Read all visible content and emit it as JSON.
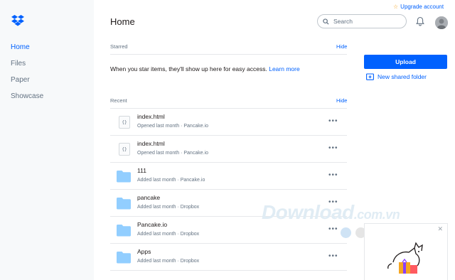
{
  "sidebar": {
    "items": [
      {
        "label": "Home"
      },
      {
        "label": "Files"
      },
      {
        "label": "Paper"
      },
      {
        "label": "Showcase"
      }
    ]
  },
  "header": {
    "title": "Home",
    "search_placeholder": "Search",
    "upgrade_label": "Upgrade account"
  },
  "starred": {
    "label": "Starred",
    "hide_label": "Hide",
    "empty_message": "When you star items, they'll show up here for easy access.",
    "learn_more": "Learn more"
  },
  "recent": {
    "label": "Recent",
    "hide_label": "Hide",
    "files": [
      {
        "name": "index.html",
        "meta": "Opened last month · Pancake.io",
        "icon": "code-file-icon"
      },
      {
        "name": "index.html",
        "meta": "Opened last month · Pancake.io",
        "icon": "code-file-icon"
      },
      {
        "name": "111",
        "meta": "Added last month · Pancake.io",
        "icon": "folder-icon"
      },
      {
        "name": "pancake",
        "meta": "Added last month · Dropbox",
        "icon": "folder-icon"
      },
      {
        "name": "Pancake.io",
        "meta": "Added last month · Dropbox",
        "icon": "folder-icon"
      },
      {
        "name": "Apps",
        "meta": "Added last month · Dropbox",
        "icon": "folder-icon"
      }
    ],
    "more_label": "•••"
  },
  "actions": {
    "upload_label": "Upload",
    "new_shared_folder_label": "New shared folder"
  },
  "watermark": {
    "main": "Download",
    "suffix": ".com.vn"
  },
  "colors": {
    "accent": "#0061fe",
    "folder": "#92ceff",
    "sidebar_bg": "#f7f9fa",
    "dots": [
      "#cfe3f5",
      "#e5e5e5",
      "#d6ecd2",
      "#f6e3b8",
      "#c4dcf2",
      "#f7c7c7"
    ]
  }
}
